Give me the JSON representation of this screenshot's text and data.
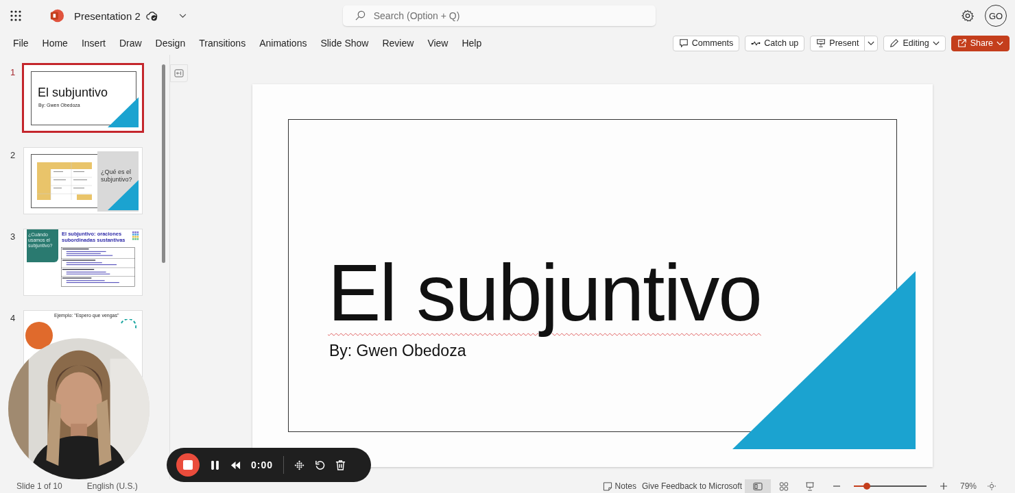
{
  "app_bar": {
    "title": "Presentation 2",
    "search": {
      "placeholder": "Search (Option + Q)"
    },
    "avatar": "GO"
  },
  "ribbon_tabs": [
    {
      "label": "File"
    },
    {
      "label": "Home"
    },
    {
      "label": "Insert"
    },
    {
      "label": "Draw"
    },
    {
      "label": "Design"
    },
    {
      "label": "Transitions"
    },
    {
      "label": "Animations"
    },
    {
      "label": "Slide Show"
    },
    {
      "label": "Review"
    },
    {
      "label": "View"
    },
    {
      "label": "Help"
    }
  ],
  "actions": [
    {
      "label": "Comments",
      "kind": "comments"
    },
    {
      "label": "Catch up",
      "kind": "catchup"
    },
    {
      "label": "Present",
      "kind": "present"
    },
    {
      "label": "Editing",
      "kind": "editing"
    },
    {
      "label": "Share",
      "kind": "share"
    }
  ],
  "slides": [
    {
      "number": "1",
      "selected": true,
      "kind": "title",
      "title": "El subjuntivo",
      "subtitle": "By: Gwen Obedoza"
    },
    {
      "number": "2",
      "selected": false,
      "kind": "table",
      "title": "¿Qué es el subjuntivo?"
    },
    {
      "number": "3",
      "selected": false,
      "kind": "list",
      "side": "¿Cuándo usamos el subjuntivo?",
      "title": "El subjuntivo:  oraciones subordinadas sustantivas"
    },
    {
      "number": "4",
      "selected": false,
      "kind": "example",
      "title": "Ejemplo: \"Espero que vengas\""
    }
  ],
  "slide": {
    "title": "El subjuntivo",
    "subtitle": "By: Gwen Obedoza"
  },
  "recorder": {
    "time": "0:00"
  },
  "status_bar": {
    "slide_info": "Slide 1 of 10",
    "language": "English (U.S.)",
    "notes": "Notes",
    "feedback": "Give Feedback to Microsoft",
    "views": [
      {
        "kind": "normal",
        "selected": true
      },
      {
        "kind": "sorter",
        "selected": false
      },
      {
        "kind": "reading",
        "selected": false
      }
    ],
    "zoom": {
      "level": 0.16,
      "reading": "79%"
    }
  }
}
